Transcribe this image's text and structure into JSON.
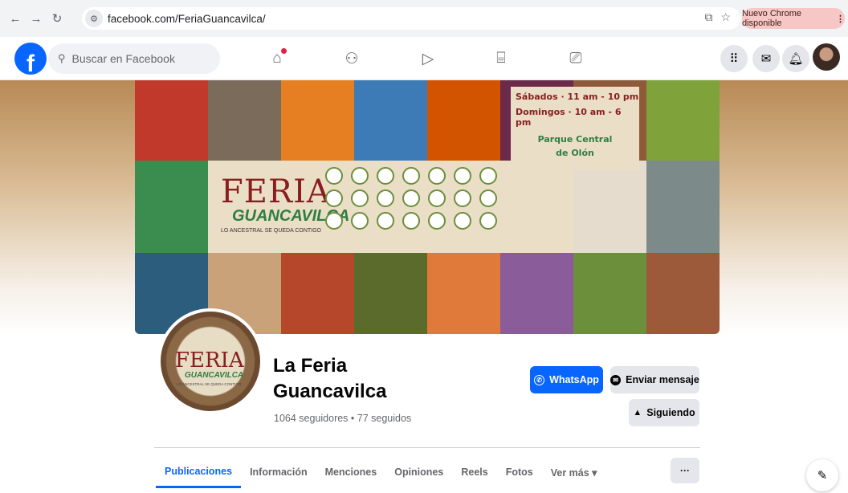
{
  "browser": {
    "url": "facebook.com/FeriaGuancavilca/",
    "update_label": "Nuevo Chrome disponible",
    "icons": [
      "back-icon",
      "forward-icon",
      "reload-icon",
      "site-info-icon",
      "install-icon",
      "bookmark-star-icon",
      "reading-mode-icon",
      "extensions-icon",
      "download-icon",
      "profile-icon",
      "menu-kebab-icon"
    ]
  },
  "facebook_header": {
    "logo_letter": "f",
    "search_placeholder": "Buscar en Facebook",
    "nav_icons": [
      "home-icon",
      "friends-icon",
      "watch-icon",
      "marketplace-icon",
      "gaming-icon"
    ],
    "right_icons": [
      "menu-grid-icon",
      "messenger-icon",
      "notifications-icon"
    ]
  },
  "cover": {
    "title": "FERIA",
    "subtitle": "GUANCAVILCA",
    "tagline": "LO ANCESTRAL SE QUEDA CONTIGO",
    "schedule_sat": "Sábados · 11 am - 10 pm",
    "schedule_sun": "Domingos · 10 am - 6 pm",
    "place_line1": "Parque Central",
    "place_line2": "de Olón",
    "tile_colors": [
      "#c0392b",
      "#7a6b5a",
      "#e67e22",
      "#3d7bb6",
      "#d35400",
      "#6c2a4a",
      "#8e5a3a",
      "#7fa33a",
      "#3b8c4f",
      "#7d8a8a",
      "#2c5d7c",
      "#c9a27a",
      "#b7472a",
      "#5a6b2c",
      "#e07a3a",
      "#8a5c9a",
      "#6b8f3a",
      "#9c5a3a",
      "#3a3a6b",
      "#b03a6b",
      "#2f8f4f",
      "#4a6b9a"
    ]
  },
  "profile": {
    "pic_title": "FERIA",
    "pic_subtitle": "GUANCAVILCA",
    "pic_tagline": "LO ANCESTRAL SE QUEDA CONTIGO",
    "name_line1": "La Feria",
    "name_line2": "Guancavilca",
    "followers": "1064 seguidores • 77 seguidos"
  },
  "actions": {
    "whatsapp": "WhatsApp",
    "message": "Enviar mensaje",
    "following": "Siguiendo"
  },
  "tabs": [
    {
      "label": "Publicaciones"
    },
    {
      "label": "Información"
    },
    {
      "label": "Menciones"
    },
    {
      "label": "Opiniones"
    },
    {
      "label": "Reels"
    },
    {
      "label": "Fotos"
    },
    {
      "label": "Ver más ▾"
    }
  ],
  "more_label": "···"
}
